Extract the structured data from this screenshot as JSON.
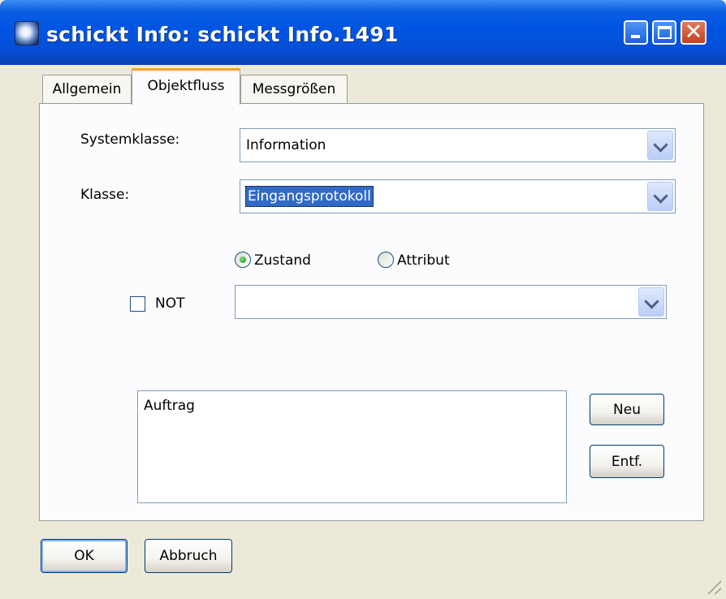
{
  "window": {
    "title": "schickt Info: schickt Info.1491",
    "icon": "app-icon",
    "controls": [
      "minimize-icon",
      "maximize-icon",
      "close-icon"
    ]
  },
  "tabs": [
    {
      "label": "Allgemein",
      "active": false
    },
    {
      "label": "Objektfluss",
      "active": true
    },
    {
      "label": "Messgrößen",
      "active": false
    }
  ],
  "form": {
    "systemklasse_label": "Systemklasse:",
    "systemklasse_value": "Information",
    "klasse_label": "Klasse:",
    "klasse_value": "Eingangsprotokoll",
    "radio_zustand": {
      "label": "Zustand",
      "checked": true
    },
    "radio_attribut": {
      "label": "Attribut",
      "checked": false
    },
    "not_checkbox": {
      "label": "NOT",
      "checked": false
    },
    "state_value": ""
  },
  "list": {
    "items": [
      "Auftrag"
    ]
  },
  "buttons": {
    "neu": "Neu",
    "entf": "Entf.",
    "ok": "OK",
    "abbruch": "Abbruch"
  },
  "colors": {
    "titlebar": "#0054e3",
    "dialog_bg": "#ece9d8",
    "selection": "#316ac5",
    "tab_highlight": "#f5a623"
  }
}
